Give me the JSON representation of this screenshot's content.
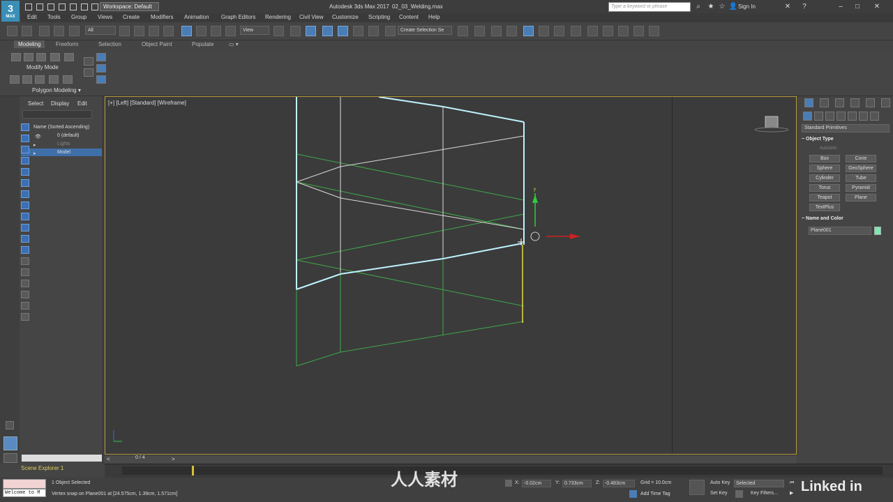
{
  "titlebar": {
    "app_logo": "3",
    "app_logo_sub": "MAX",
    "workspace": "Workspace: Default",
    "app_title": "Autodesk 3ds Max 2017",
    "document": "02_03_Welding.max",
    "search_placeholder": "Type a keyword or phrase",
    "sign_in": "Sign In"
  },
  "menu": [
    "Edit",
    "Tools",
    "Group",
    "Views",
    "Create",
    "Modifiers",
    "Animation",
    "Graph Editors",
    "Rendering",
    "Civil View",
    "Customize",
    "Scripting",
    "Content",
    "Help"
  ],
  "toolbar": {
    "filter": "All",
    "ref_coord": "View",
    "selection_set": "Create Selection Se"
  },
  "ribbon": {
    "tabs": [
      "Modeling",
      "Freeform",
      "Selection",
      "Object Paint",
      "Populate"
    ],
    "active_tab": "Modeling",
    "modify_mode": "Modify Mode",
    "polygon_modeling": "Polygon Modeling"
  },
  "scene_explorer": {
    "tabs": [
      "Select",
      "Display",
      "Edit"
    ],
    "header": "Name (Sorted Ascending)",
    "rows": [
      {
        "label": "0 (default)",
        "selected": false
      },
      {
        "label": "Lights",
        "selected": false
      },
      {
        "label": "Model",
        "selected": true
      }
    ],
    "footer_label": "Scene Explorer 1"
  },
  "viewport": {
    "label": "[+] [Left] [Standard] [Wireframe]"
  },
  "command_panel": {
    "category": "Standard Primitives",
    "object_type_title": "Object Type",
    "autogrid": "AutoGrid",
    "buttons": [
      "Box",
      "Cone",
      "Sphere",
      "GeoSphere",
      "Cylinder",
      "Tube",
      "Torus",
      "Pyramid",
      "Teapot",
      "Plane",
      "TextPlus"
    ],
    "name_color_title": "Name and Color",
    "object_name": "Plane001",
    "object_color": "#7de8b0"
  },
  "time_slider": {
    "frame": "0 / 4",
    "prev": "<",
    "next": ">"
  },
  "status": {
    "maxscript_output": "Welcome to M",
    "selected": "1 Object Selected",
    "prompt": "Vertex snap on Plane001 at [24.575cm, 1.39cm, 1.571cm]",
    "x_label": "X:",
    "x_value": "-0.02cm",
    "y_label": "Y:",
    "y_value": "0.733cm",
    "z_label": "Z:",
    "z_value": "-0.483cm",
    "grid": "Grid = 10.0cm",
    "add_time_tag": "Add Time Tag",
    "auto_key": "Auto Key",
    "set_key": "Set Key",
    "key_mode": "Selected",
    "key_filters": "Key Filters...",
    "linkedin": "Linked in"
  },
  "watermark": "人人素材",
  "colors": {
    "viewport_border": "#b89a3a",
    "selected_edge": "#bff3ff",
    "green_edge": "#3fa84a",
    "white_edge": "#dcdcdc",
    "yellow_edge": "#e8dc40"
  }
}
